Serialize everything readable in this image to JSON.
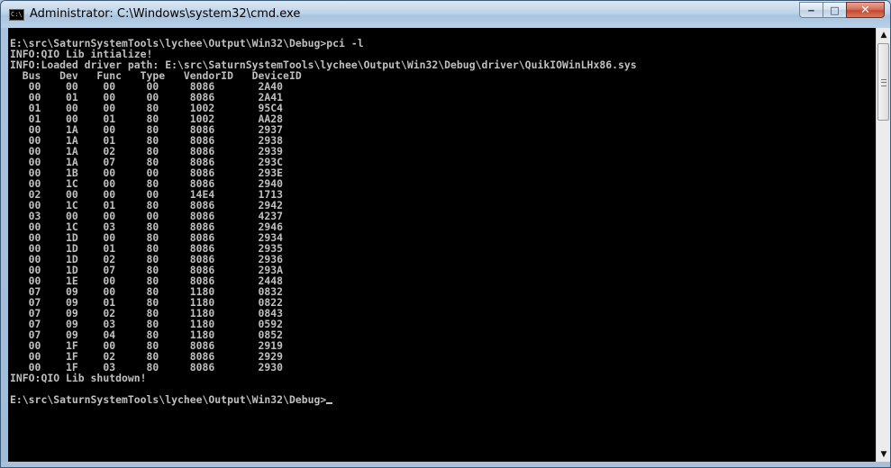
{
  "window": {
    "title": "Administrator: C:\\Windows\\system32\\cmd.exe",
    "icon": "cmd-icon",
    "buttons": {
      "minimize": "‒",
      "maximize": "□",
      "close": "✕"
    }
  },
  "console": {
    "command_line": "E:\\src\\SaturnSystemTools\\lychee\\Output\\Win32\\Debug>pci -l",
    "info_init": "INFO:QIO Lib intialize!",
    "info_driver": "INFO:Loaded driver path: E:\\src\\SaturnSystemTools\\lychee\\Output\\Win32\\Debug\\driver\\QuikIOWinLHx86.sys",
    "table_header": "  Bus   Dev   Func   Type   VendorID   DeviceID",
    "table_rows": [
      "   00    00    00     00     8086       2A40",
      "   00    01    00     00     8086       2A41",
      "   01    00    00     80     1002       95C4",
      "   01    00    01     80     1002       AA28",
      "   00    1A    00     80     8086       2937",
      "   00    1A    01     80     8086       2938",
      "   00    1A    02     80     8086       2939",
      "   00    1A    07     80     8086       293C",
      "   00    1B    00     00     8086       293E",
      "   00    1C    00     80     8086       2940",
      "   02    00    00     00     14E4       1713",
      "   00    1C    01     80     8086       2942",
      "   03    00    00     00     8086       4237",
      "   00    1C    03     80     8086       2946",
      "   00    1D    00     80     8086       2934",
      "   00    1D    01     80     8086       2935",
      "   00    1D    02     80     8086       2936",
      "   00    1D    07     80     8086       293A",
      "   00    1E    00     80     8086       2448",
      "   07    09    00     80     1180       0832",
      "   07    09    01     80     1180       0822",
      "   07    09    02     80     1180       0843",
      "   07    09    03     80     1180       0592",
      "   07    09    04     80     1180       0852",
      "   00    1F    00     80     8086       2919",
      "   00    1F    02     80     8086       2929",
      "   00    1F    03     80     8086       2930"
    ],
    "info_shutdown": "INFO:QIO Lib shutdown!",
    "blank": "",
    "prompt": "E:\\src\\SaturnSystemTools\\lychee\\Output\\Win32\\Debug>"
  },
  "scrollbar": {
    "up_arrow": "▲",
    "down_arrow": "▼"
  },
  "colors": {
    "console_bg": "#000000",
    "console_fg": "#c0c0c0",
    "frame": "#a9c4de"
  }
}
